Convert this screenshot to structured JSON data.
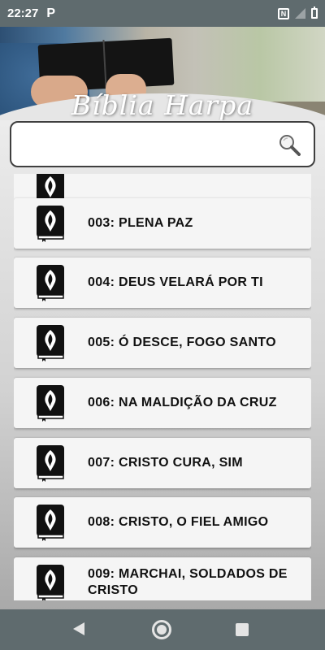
{
  "status_bar": {
    "time": "22:27",
    "app_indicator": "P",
    "nfc_label": "N",
    "icons": [
      "nfc-icon",
      "signal-icon",
      "battery-icon"
    ]
  },
  "header": {
    "title": "Bíblia Harpa"
  },
  "search": {
    "value": "",
    "placeholder": "",
    "icon": "search-icon"
  },
  "hymns": [
    {
      "label": ""
    },
    {
      "label": "003: PLENA PAZ"
    },
    {
      "label": "004: DEUS VELARÁ POR TI"
    },
    {
      "label": "005: Ó DESCE, FOGO SANTO"
    },
    {
      "label": "006: NA MALDIÇÃO DA CRUZ"
    },
    {
      "label": "007: CRISTO CURA, SIM"
    },
    {
      "label": "008: CRISTO, O FIEL AMIGO"
    },
    {
      "label": "009: MARCHAI, SOLDADOS DE CRISTO"
    }
  ],
  "nav": {
    "back": "back-icon",
    "home": "home-icon",
    "recent": "recent-apps-icon"
  }
}
